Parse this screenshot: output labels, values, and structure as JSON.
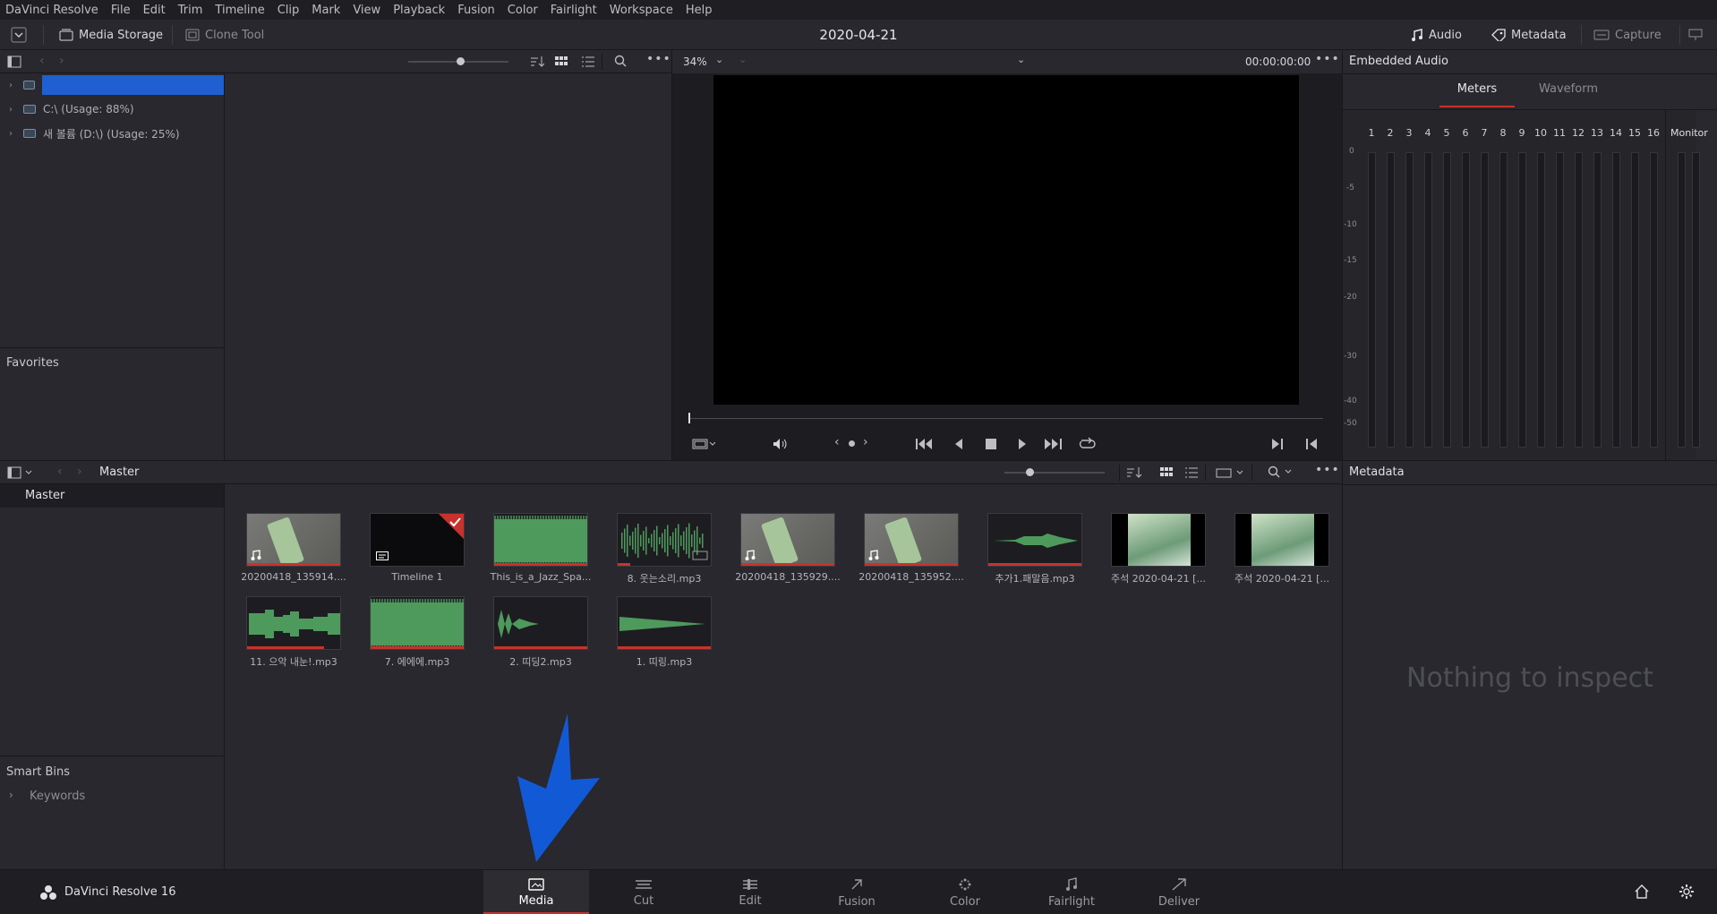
{
  "menu": [
    "DaVinci Resolve",
    "File",
    "Edit",
    "Trim",
    "Timeline",
    "Clip",
    "Mark",
    "View",
    "Playback",
    "Fusion",
    "Color",
    "Fairlight",
    "Workspace",
    "Help"
  ],
  "toolbar": {
    "media_storage": "Media Storage",
    "clone_tool": "Clone Tool",
    "title": "2020-04-21",
    "audio": "Audio",
    "metadata": "Metadata",
    "capture": "Capture"
  },
  "storage": {
    "drives": [
      "C:\\ (Usage: 88%)",
      "새 볼륨 (D:\\) (Usage: 25%)"
    ],
    "favorites": "Favorites"
  },
  "viewer": {
    "zoom": "34%",
    "timecode": "00:00:00:00"
  },
  "audio_panel": {
    "title": "Embedded Audio",
    "tabs": [
      "Meters",
      "Waveform"
    ],
    "active_tab": "Meters",
    "channels": [
      "1",
      "2",
      "3",
      "4",
      "5",
      "6",
      "7",
      "8",
      "9",
      "10",
      "11",
      "12",
      "13",
      "14",
      "15",
      "16"
    ],
    "monitor": "Monitor",
    "db_scale": [
      "0",
      "-5",
      "-10",
      "-15",
      "-20",
      "-30",
      "-40",
      "-50"
    ]
  },
  "media_pool": {
    "breadcrumb": "Master",
    "bins": [
      "Master"
    ],
    "smart_bins": "Smart Bins",
    "keywords": "Keywords",
    "clips": [
      {
        "label": "20200418_135914....",
        "kind": "video"
      },
      {
        "label": "Timeline 1",
        "kind": "timeline"
      },
      {
        "label": "This_is_a_Jazz_Spa...",
        "kind": "audio-full"
      },
      {
        "label": "8. 웃는소리.mp3",
        "kind": "audio-spiky"
      },
      {
        "label": "20200418_135929....",
        "kind": "video"
      },
      {
        "label": "20200418_135952....",
        "kind": "video"
      },
      {
        "label": "추가1.패말음.mp3",
        "kind": "audio-thin"
      },
      {
        "label": "주석 2020-04-21 [...",
        "kind": "image"
      },
      {
        "label": "주석 2020-04-21 [...",
        "kind": "image"
      },
      {
        "label": "11. 으악 내눈!.mp3",
        "kind": "audio-blocky"
      },
      {
        "label": "7. 에에에.mp3",
        "kind": "audio-full"
      },
      {
        "label": "2. 띠딩2.mp3",
        "kind": "audio-decay"
      },
      {
        "label": "1. 띠링.mp3",
        "kind": "audio-ramp"
      }
    ]
  },
  "metadata_panel": {
    "title": "Metadata",
    "empty_text": "Nothing to inspect"
  },
  "bottom": {
    "app_name": "DaVinci Resolve 16",
    "pages": [
      "Media",
      "Cut",
      "Edit",
      "Fusion",
      "Color",
      "Fairlight",
      "Deliver"
    ],
    "active_page": "Media"
  },
  "colors": {
    "accent_red": "#c8322c",
    "selection_blue": "#1f5fd1",
    "waveform_green": "#4e9a5c",
    "annotation_arrow": "#1259d6"
  }
}
